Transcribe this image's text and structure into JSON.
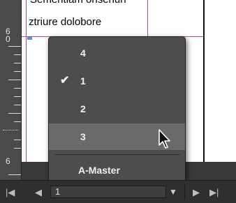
{
  "document": {
    "text_line_1": "Sementiam onsenun",
    "text_line_2": "ztriure dolobore"
  },
  "ruler": {
    "top_number": "60",
    "bottom_number": "6"
  },
  "page_menu": {
    "items": [
      {
        "label": "4",
        "checked": false,
        "highlighted": false
      },
      {
        "label": "1",
        "checked": true,
        "highlighted": false
      },
      {
        "label": "2",
        "checked": false,
        "highlighted": false
      },
      {
        "label": "3",
        "checked": false,
        "highlighted": true
      }
    ],
    "master_label": "A-Master",
    "check_glyph": "✔"
  },
  "nav": {
    "first_page_glyph": "|◀",
    "prev_page_glyph": "◀",
    "current_page": "1",
    "dropdown_glyph": "▼",
    "next_page_glyph": "▶",
    "last_page_glyph": "▶|"
  }
}
